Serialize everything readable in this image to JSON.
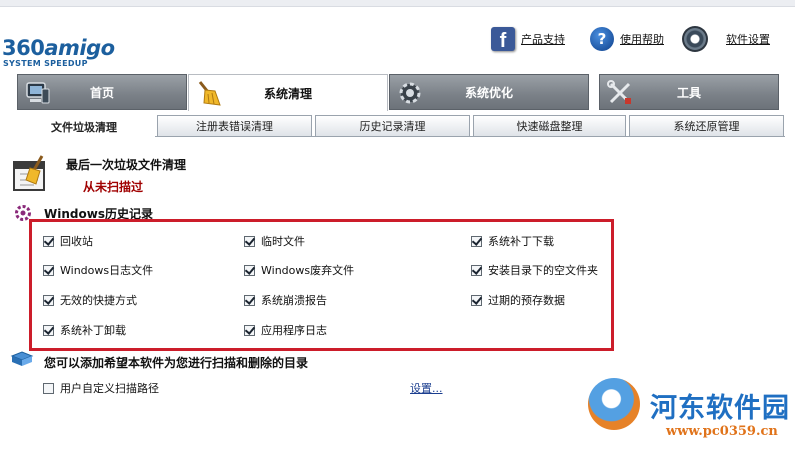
{
  "app": {
    "logo_number": "360",
    "logo_name": "amigo",
    "logo_tagline": "SYSTEM SPEEDUP"
  },
  "header": {
    "links": [
      {
        "label": "产品支持",
        "icon": "facebook-icon"
      },
      {
        "label": "使用帮助",
        "icon": "help-icon"
      },
      {
        "label": "软件设置",
        "icon": "gear-icon"
      }
    ]
  },
  "main_tabs": [
    {
      "label": "首页",
      "icon": "computer-icon",
      "active": false
    },
    {
      "label": "系统清理",
      "icon": "broom-icon",
      "active": true
    },
    {
      "label": "系统优化",
      "icon": "gear-icon",
      "active": false
    },
    {
      "label": "工具",
      "icon": "tools-icon",
      "active": false
    }
  ],
  "sub_tabs": [
    {
      "label": "文件垃圾清理",
      "active": true
    },
    {
      "label": "注册表错误清理",
      "active": false
    },
    {
      "label": "历史记录清理",
      "active": false
    },
    {
      "label": "快速磁盘整理",
      "active": false
    },
    {
      "label": "系统还原管理",
      "active": false
    }
  ],
  "last_clean": {
    "title": "最后一次垃圾文件清理",
    "value": "从未扫描过"
  },
  "history": {
    "title": "Windows历史记录",
    "items": [
      {
        "label": "回收站",
        "checked": true
      },
      {
        "label": "临时文件",
        "checked": true
      },
      {
        "label": "系统补丁下载",
        "checked": true
      },
      {
        "label": "Windows日志文件",
        "checked": true
      },
      {
        "label": "Windows废弃文件",
        "checked": true
      },
      {
        "label": "安装目录下的空文件夹",
        "checked": true
      },
      {
        "label": "无效的快捷方式",
        "checked": true
      },
      {
        "label": "系统崩溃报告",
        "checked": true
      },
      {
        "label": "过期的预存数据",
        "checked": true
      },
      {
        "label": "系统补丁卸载",
        "checked": true
      },
      {
        "label": "应用程序日志",
        "checked": true
      }
    ]
  },
  "custom_dirs": {
    "title": "您可以添加希望本软件为您进行扫描和删除的目录",
    "checkbox_label": "用户自定义扫描路径",
    "checked": false,
    "settings_link": "设置..."
  },
  "watermark": {
    "name": "河东软件园",
    "url": "www.pc0359.cn"
  },
  "colors": {
    "brand": "#1c5f9e",
    "highlight_frame": "#cc1d2a",
    "status_red": "#a00000",
    "tab_gray": "#7a8087"
  }
}
